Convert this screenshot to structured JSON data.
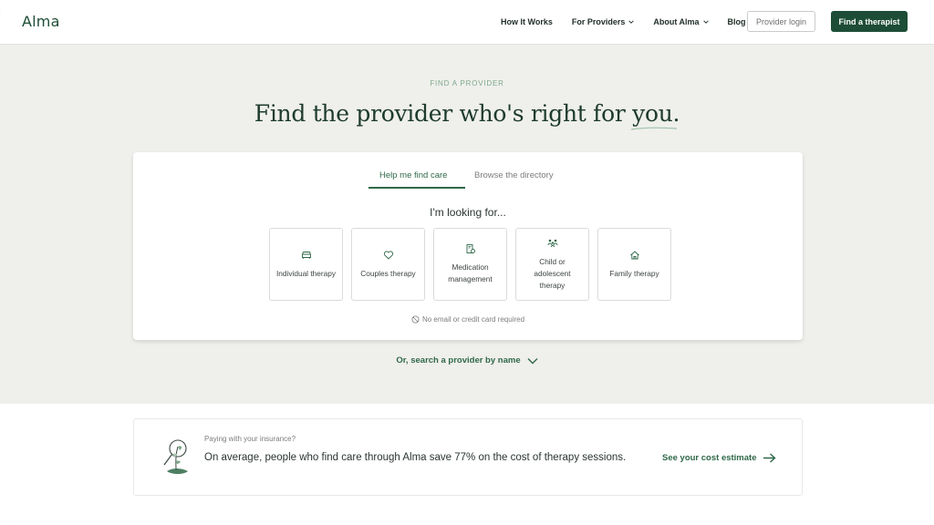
{
  "nav": {
    "logo": "Alma",
    "links": [
      "How It Works",
      "For Providers",
      "About Alma",
      "Blog"
    ],
    "provider_login": "Provider login",
    "find_therapist": "Find a therapist"
  },
  "hero": {
    "eyebrow": "FIND A PROVIDER",
    "headline_prefix": "Find the provider who's right for ",
    "headline_accent": "you",
    "headline_suffix": "."
  },
  "card": {
    "tabs": [
      {
        "label": "Help me find care",
        "active": true
      },
      {
        "label": "Browse the directory",
        "active": false
      }
    ],
    "prompt": "I'm looking for...",
    "options": [
      {
        "label": "Individual therapy",
        "icon": "couch-icon"
      },
      {
        "label": "Couples therapy",
        "icon": "heart-icon"
      },
      {
        "label": "Medication management",
        "icon": "prescription-icon"
      },
      {
        "label": "Child or adolescent therapy",
        "icon": "family-group-icon"
      },
      {
        "label": "Family therapy",
        "icon": "home-icon"
      }
    ],
    "notice": "No email or credit card required"
  },
  "search_by_name": "Or, search a provider by name",
  "insurance": {
    "small": "Paying with your insurance?",
    "main": "On average, people who find care through Alma save 77% on the cost of therapy sessions.",
    "link": "See your cost estimate"
  },
  "colors": {
    "brand": "#1d4d36",
    "accent": "#2f6848",
    "background": "#efefec"
  }
}
